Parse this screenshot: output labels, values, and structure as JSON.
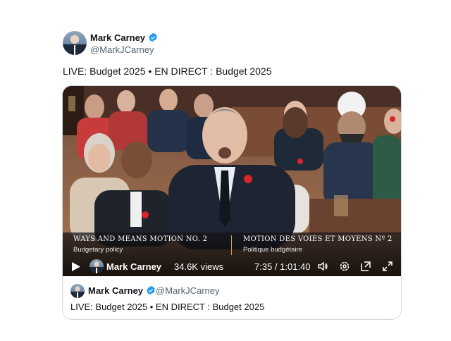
{
  "tweet": {
    "author_name": "Mark Carney",
    "author_handle": "@MarkJCarney",
    "text": "LIVE: Budget 2025 • EN DIRECT : Budget 2025",
    "verified_color": "#1d9bf0"
  },
  "video": {
    "lower_third": {
      "title_en": "WAYS AND MEANS MOTION NO. 2",
      "subtitle_en": "Budgetary policy",
      "title_fr": "MOTION DES VOIES ET MOYENS Nº 2",
      "subtitle_fr": "Politique budgétaire"
    },
    "author_name": "Mark Carney",
    "views": "34.6K views",
    "time": "7:35 / 1:01:40",
    "icons": [
      "play-icon",
      "volume-icon",
      "settings-icon",
      "pip-icon",
      "fullscreen-icon"
    ]
  },
  "quote": {
    "author_name": "Mark Carney",
    "author_handle": "@MarkJCarney",
    "text": "LIVE: Budget 2025 • EN DIRECT : Budget 2025"
  }
}
